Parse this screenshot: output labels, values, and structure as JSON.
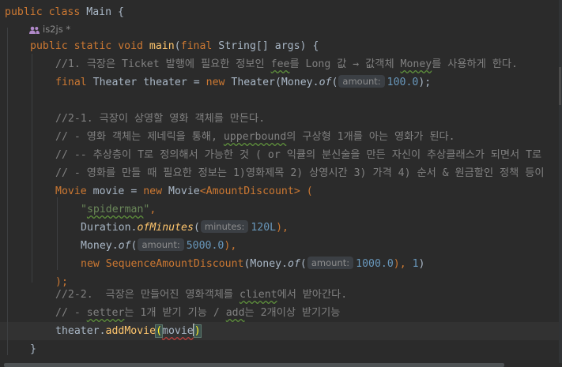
{
  "code": {
    "l1": {
      "kw1": "public",
      "kw2": "class",
      "name": "Main",
      "brace": "{"
    },
    "author": "is2js *",
    "l3": {
      "kw1": "public",
      "kw2": "static",
      "kw3": "void",
      "fn": "main",
      "p1": "(",
      "kw4": "final",
      "type": "String[]",
      "param": "args",
      "p2": ")",
      "brace": "{"
    },
    "l4": {
      "pre": "//1. 극장은 Ticket 발행에 필요한 정보인 ",
      "typo": "fee",
      "mid": "를 Long 값 → 값객체 ",
      "typo2": "Money",
      "post": "를 사용하게 한다."
    },
    "l5": {
      "kw1": "final",
      "type": "Theater",
      "var": "theater",
      "eq": "=",
      "kw2": "new",
      "cls": "Theater(Money.",
      "method": "of",
      "paren": "(",
      "hint": "amount:",
      "num": "100.0",
      "close": ");"
    },
    "l7": "//2-1. 극장이 상영할 영화 객체를 만든다.",
    "l8": {
      "pre": "// - 영화 객체는 제네릭을 통해, ",
      "typo": "upperbound",
      "post": "의 구상형 1개를 아는 영화가 된다."
    },
    "l9": "// -- 추상층이 T로 정의해서 가능한 것 ( or 익큘의 분신술을 만든 자신이 추상클래스가 되면서 T로",
    "l10": "// - 영화를 만들 때 필요한 정보는 1)영화제목 2) 상영시간 3) 가격 4) 순서 & 원금할인 정책 등이",
    "l11": {
      "type": "Movie",
      "var": "movie",
      "eq": "=",
      "kw": "new",
      "cls": "Movie",
      "lt": "<",
      "gen": "AmountDiscount",
      "gt": ">",
      "paren": "("
    },
    "l12": {
      "q1": "\"",
      "str": "spiderman",
      "q2": "\"",
      "comma": ","
    },
    "l13": {
      "cls": "Duration.",
      "method": "ofMinutes",
      "paren": "(",
      "hint": "minutes:",
      "num": "120L",
      "close": "),"
    },
    "l14": {
      "cls": "Money.",
      "method": "of",
      "paren": "(",
      "hint": "amount:",
      "num": "5000.0",
      "close": "),"
    },
    "l15": {
      "kw": "new",
      "cls": "SequenceAmountDiscount",
      "p1": "(Money.",
      "method": "of",
      "paren": "(",
      "hint": "amount:",
      "num": "1000.0",
      "close": "), ",
      "num2": "1",
      "end": ")"
    },
    "l16": ");",
    "l17": {
      "pre": "//2-2.  극장은 만들어진 영화객체를 ",
      "typo": "client",
      "post": "에서 받아간다."
    },
    "l18": {
      "pre": "// - ",
      "typo": "setter",
      "mid": "는 1개 받기 기능 / ",
      "typo2": "add",
      "post": "는 2개이상 받기기능"
    },
    "l19": {
      "obj": "theater.",
      "fn": "addMovie",
      "open": "(",
      "arg": "movie",
      "close": ")"
    },
    "l20": "}"
  },
  "colors": {
    "background": "#2b2b2b",
    "keyword": "#cc7832",
    "function": "#ffc66d",
    "number": "#6897bb",
    "string": "#6a8759",
    "comment": "#808080",
    "text": "#a9b7c6"
  }
}
